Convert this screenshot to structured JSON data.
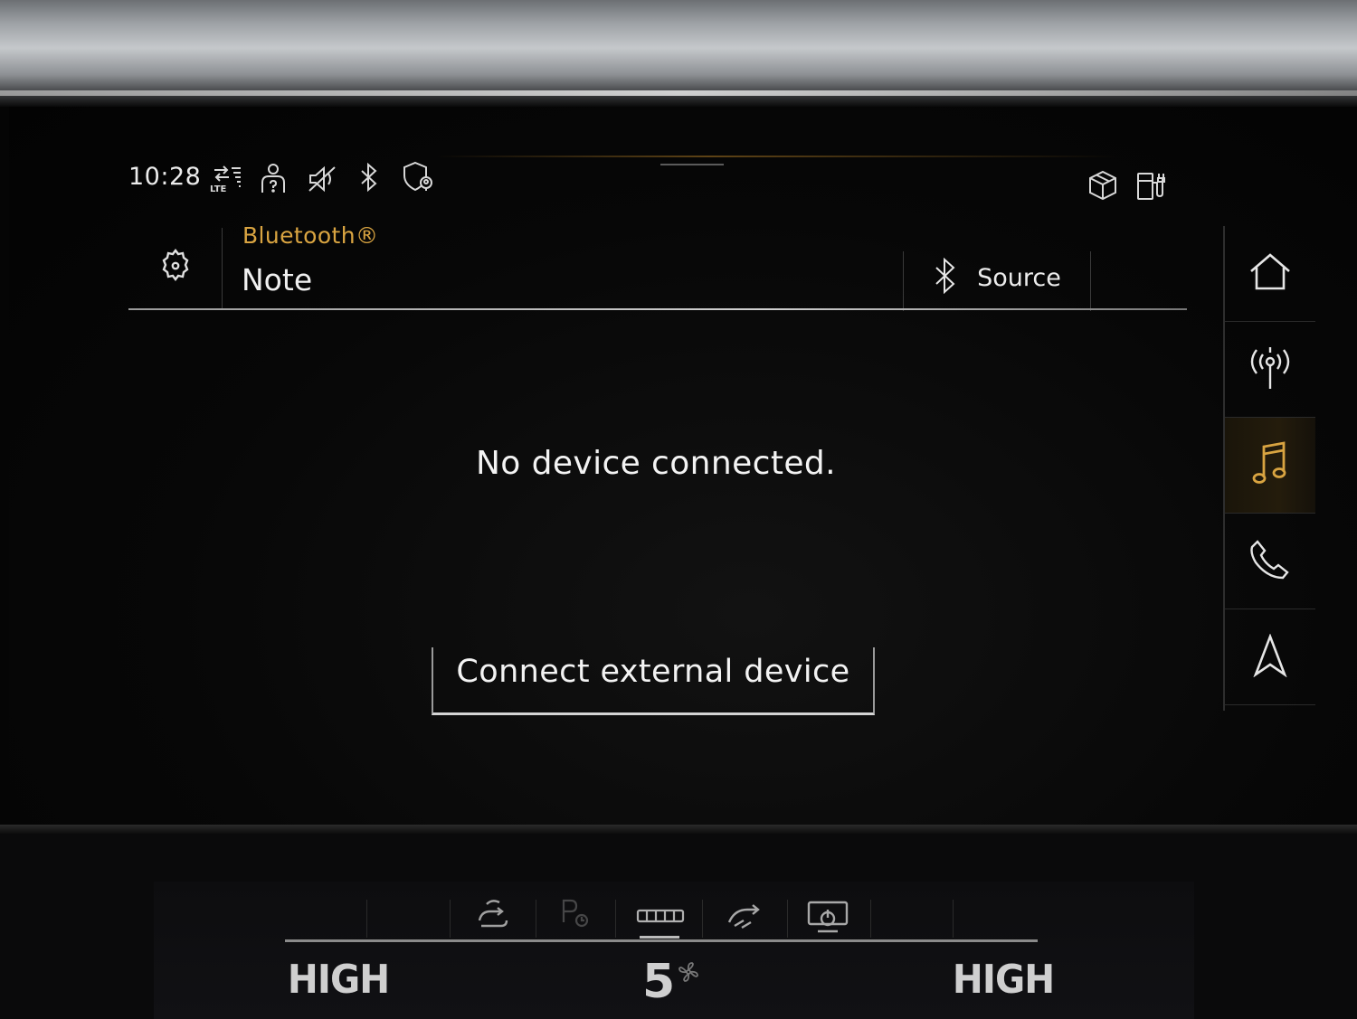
{
  "status_bar": {
    "time": "10:28",
    "icons": [
      "lte-data-icon",
      "driver-profile-icon",
      "mute-icon",
      "bluetooth-icon",
      "location-privacy-icon",
      "car-3d-icon",
      "charging-station-icon"
    ]
  },
  "header": {
    "subtitle": "Bluetooth®",
    "title": "Note",
    "source_label": "Source"
  },
  "content": {
    "message": "No device connected.",
    "connect_button_label": "Connect external device"
  },
  "nav": {
    "items": [
      "home",
      "radio",
      "media",
      "phone",
      "navigation"
    ],
    "active": "media"
  },
  "climate": {
    "left_temp": "HIGH",
    "right_temp": "HIGH",
    "fan_level": "5"
  },
  "colors": {
    "accent": "#d9a441",
    "background": "#050505",
    "text": "#f0f0f0"
  }
}
